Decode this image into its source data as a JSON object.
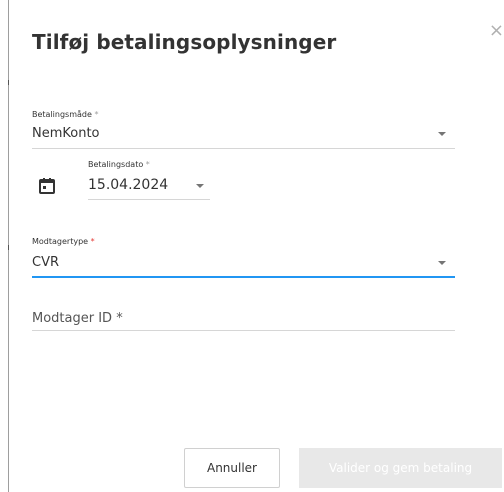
{
  "dialog": {
    "title": "Tilføj betalingsoplysninger",
    "close_glyph": "×"
  },
  "payment_method": {
    "label": "Betalingsmåde",
    "required_mark": "*",
    "value": "NemKonto"
  },
  "payment_date": {
    "label": "Betalingsdato",
    "required_mark": "*",
    "value": "15.04.2024",
    "icon": "calendar-icon"
  },
  "recipient_type": {
    "label": "Modtagertype",
    "required_mark": "*",
    "value": "CVR"
  },
  "recipient_id": {
    "placeholder": "Modtager ID *",
    "value": ""
  },
  "actions": {
    "cancel_label": "Annuller",
    "submit_label": "Valider og gem betaling"
  },
  "colors": {
    "accent": "#2196f3",
    "required_red": "#e53935",
    "disabled_button": "#e8e8e8"
  }
}
